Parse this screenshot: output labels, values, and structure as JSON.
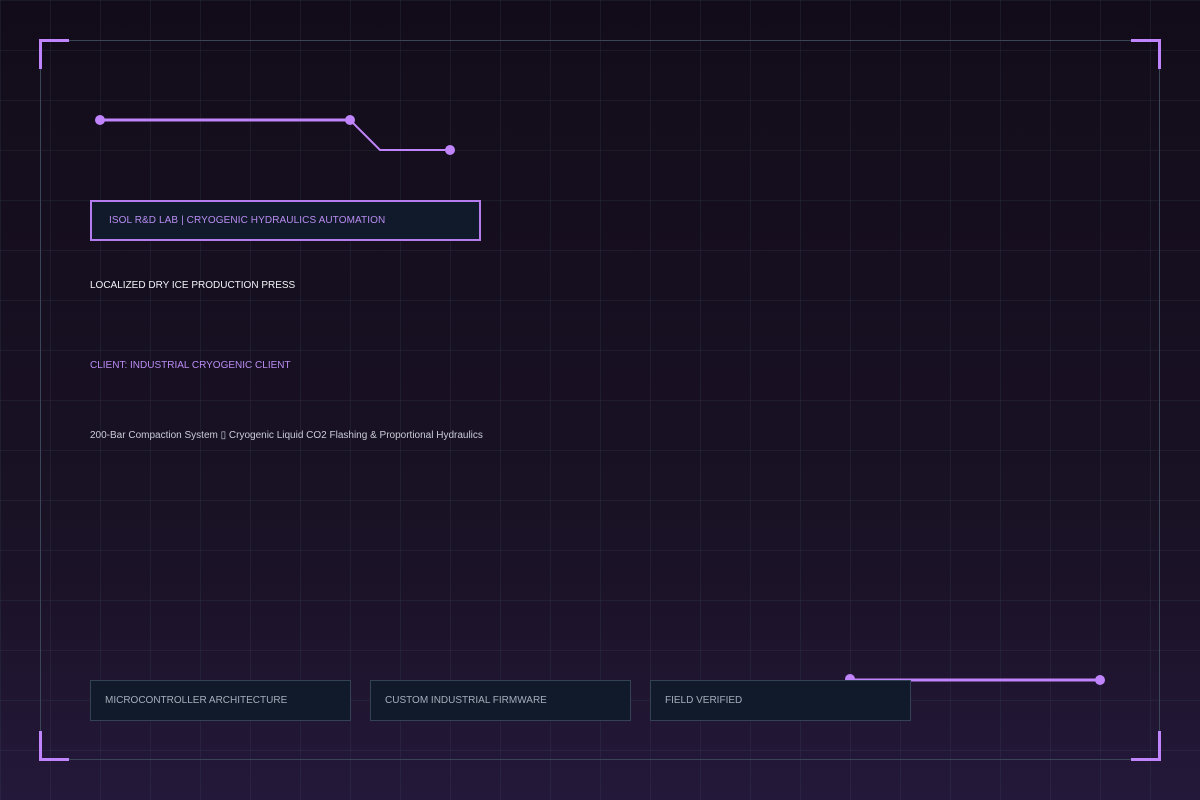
{
  "header": {
    "label": "ISOL R&D LAB | CRYOGENIC HYDRAULICS AUTOMATION"
  },
  "project": {
    "title": "LOCALIZED DRY ICE PRODUCTION PRESS",
    "client": "CLIENT: INDUSTRIAL CRYOGENIC CLIENT",
    "description": "200-Bar Compaction System ▯ Cryogenic Liquid CO2 Flashing & Proportional Hydraulics"
  },
  "tags": [
    {
      "label": "MICROCONTROLLER ARCHITECTURE"
    },
    {
      "label": "CUSTOM INDUSTRIAL FIRMWARE"
    },
    {
      "label": "FIELD VERIFIED"
    }
  ],
  "theme": {
    "accent": "#c084fc",
    "frame_border": "#3a4658",
    "panel_bg": "#111a2a",
    "page_bg": "#150f1e"
  }
}
